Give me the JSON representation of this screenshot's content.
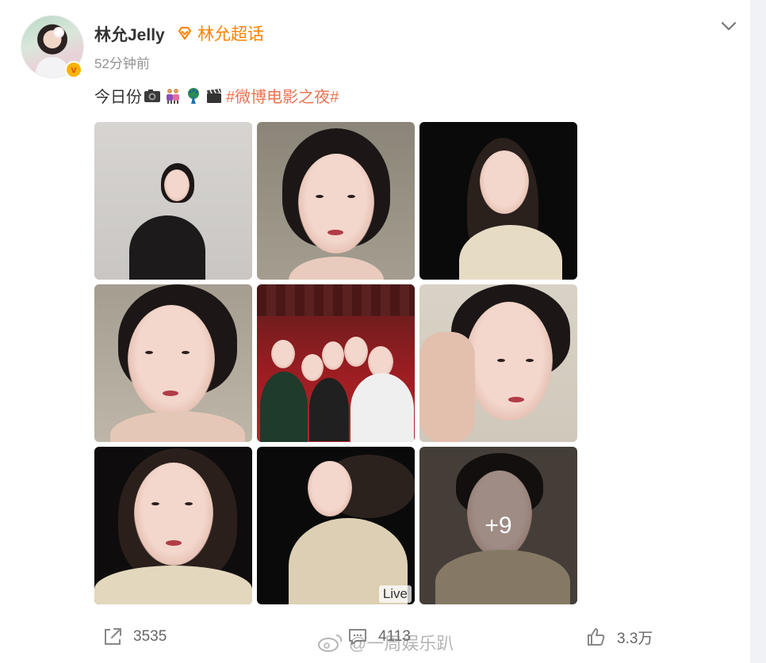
{
  "post": {
    "author": "林允Jelly",
    "supertopic_label": "林允超话",
    "time": "52分钟前",
    "text_prefix": "今日份",
    "emojis": [
      "camera-emoji",
      "two-women-emoji",
      "peacock-emoji",
      "clapper-board-emoji"
    ],
    "hashtag": "#微博电影之夜#",
    "more_count": "+9",
    "live_label": "Live"
  },
  "actions": {
    "forward_count": "3535",
    "comment_count": "4113",
    "like_count": "3.3万"
  },
  "watermark": "@一周娱乐趴",
  "colors": {
    "hashtag": "#eb7350",
    "supertopic": "#ff8200",
    "text": "#333333",
    "muted": "#939393"
  }
}
